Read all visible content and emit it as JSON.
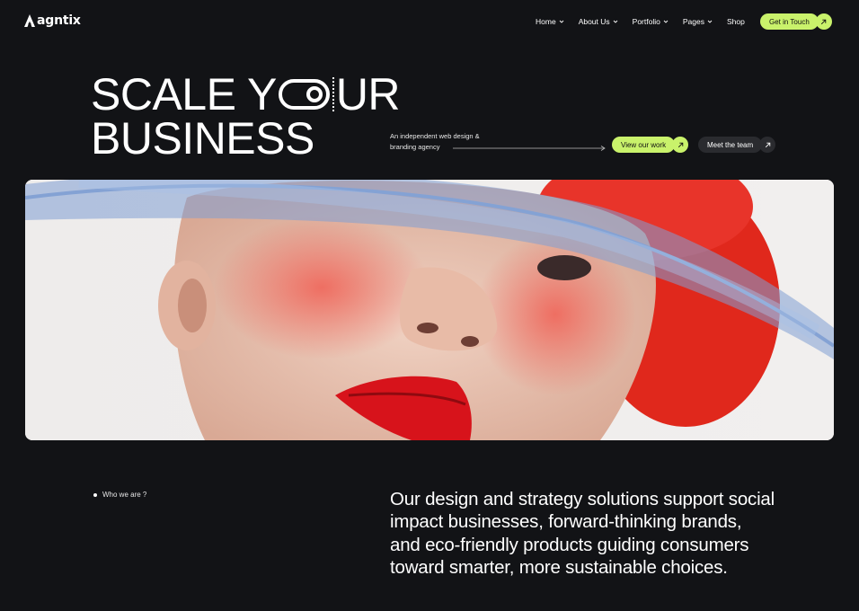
{
  "brand": {
    "name": "agntix",
    "icon": "logo-a-mark"
  },
  "nav": {
    "items": [
      {
        "label": "Home",
        "has_dropdown": true
      },
      {
        "label": "About Us",
        "has_dropdown": true
      },
      {
        "label": "Portfolio",
        "has_dropdown": true
      },
      {
        "label": "Pages",
        "has_dropdown": true
      },
      {
        "label": "Shop",
        "has_dropdown": false
      }
    ],
    "cta_label": "Get in Touch"
  },
  "hero": {
    "line1_start": "SCALE Y",
    "line1_end": "UR",
    "line2": "BUSINESS",
    "tagline": "An independent web design & branding agency",
    "primary_button": "View our work",
    "secondary_button": "Meet the team",
    "image_alt": "woman-portrait-with-blue-feather"
  },
  "about": {
    "label": "Who we are ?",
    "statement": "Our design and strategy solutions support social impact businesses, forward-thinking brands, and eco-friendly products guiding consumers toward smarter, more sustainable choices."
  },
  "colors": {
    "background": "#121316",
    "accent": "#c9f26b",
    "dark_pill": "#2a2b2f",
    "text": "#ffffff"
  }
}
